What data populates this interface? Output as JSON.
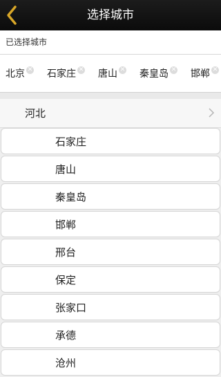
{
  "header": {
    "title": "选择城市",
    "back_icon": "chevron-left-icon",
    "accent_color": "#d9a728"
  },
  "selected": {
    "label": "已选择城市",
    "chips": [
      {
        "label": "北京"
      },
      {
        "label": "石家庄"
      },
      {
        "label": "唐山"
      },
      {
        "label": "秦皇岛"
      },
      {
        "label": "邯郸"
      }
    ],
    "remove_icon": "close-icon"
  },
  "province": {
    "label": "河北",
    "icon": "chevron-right-icon"
  },
  "cities": [
    {
      "label": "石家庄"
    },
    {
      "label": "唐山"
    },
    {
      "label": "秦皇岛"
    },
    {
      "label": "邯郸"
    },
    {
      "label": "邢台"
    },
    {
      "label": "保定"
    },
    {
      "label": "张家口"
    },
    {
      "label": "承德"
    },
    {
      "label": "沧州"
    }
  ]
}
